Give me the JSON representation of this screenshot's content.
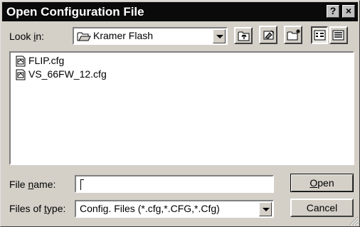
{
  "window": {
    "title": "Open Configuration File"
  },
  "titlebar": {
    "help_label": "?",
    "close_label": "×"
  },
  "lookin": {
    "label_pre": "Look ",
    "label_hot": "i",
    "label_post": "n:",
    "value": "Kramer Flash"
  },
  "toolbar": {
    "up_icon": "up-one-level-icon",
    "desktop_icon": "desktop-icon",
    "newfolder_icon": "new-folder-icon",
    "list_icon": "list-view-icon",
    "details_icon": "details-view-icon"
  },
  "files": [
    {
      "name": "FLIP.cfg",
      "icon": "config-file-icon"
    },
    {
      "name": "VS_66FW_12.cfg",
      "icon": "config-file-icon"
    }
  ],
  "filename": {
    "label_pre": "File ",
    "label_hot": "n",
    "label_post": "ame:",
    "value": ""
  },
  "filetype": {
    "label_pre": "Files of ",
    "label_hot": "t",
    "label_post": "ype:",
    "value": "Config. Files (*.cfg,*.CFG,*.Cfg)"
  },
  "buttons": {
    "open_hot": "O",
    "open_rest": "pen",
    "cancel": "Cancel"
  }
}
